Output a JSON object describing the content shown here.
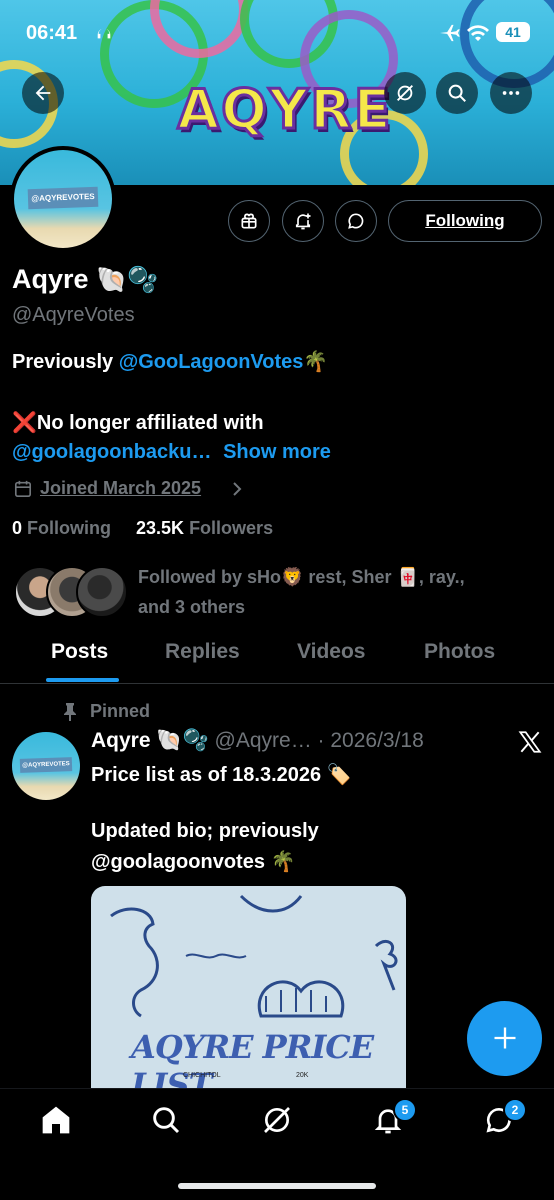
{
  "status_bar": {
    "time": "06:41",
    "battery": "41"
  },
  "banner": {
    "title": "AQYRE"
  },
  "header": {
    "avatar_text": "@AQYREVOTES",
    "following_label": "Following"
  },
  "profile": {
    "name": "Aqyre",
    "name_emoji": "🐚🫧",
    "handle": "@AqyreVotes",
    "bio_line1_prefix": "Previously ",
    "bio_line1_mention": "@GooLagoonVotes",
    "bio_line1_emoji": "🌴",
    "bio_line2": "❌No longer affiliated with",
    "bio_line3_mention": "@goolagoonbacku…",
    "show_more": "Show more",
    "joined": "Joined March 2025",
    "following_count": "0",
    "following_label": "Following",
    "followers_count": "23.5K",
    "followers_label": "Followers",
    "followed_by_line1": "Followed by sHo🦁 rest, Sher 🀄, ray.,",
    "followed_by_line2": "and 3 others"
  },
  "tabs": [
    {
      "label": "Posts",
      "active": true
    },
    {
      "label": "Replies"
    },
    {
      "label": "Videos"
    },
    {
      "label": "Photos"
    }
  ],
  "post": {
    "pinned_label": "Pinned",
    "author": "Aqyre",
    "author_emoji": "🐚🫧",
    "handle_date": "@Aqyre… · 2026/3/18",
    "avatar_text": "@AQYREVOTES",
    "line1": "Price list as of 18.3.2026 🏷️",
    "line2": "Updated bio; previously",
    "line3": "@goolagoonvotes 🌴",
    "image_title": "AQYRE PRICE LIST",
    "image_row_left": "CHICHITOL",
    "image_row_right": "20K"
  },
  "bottom_nav": {
    "notifications_badge": "5",
    "messages_badge": "2"
  },
  "colors": {
    "accent": "#1d9bf0",
    "background": "#000000",
    "muted": "#71767b"
  }
}
